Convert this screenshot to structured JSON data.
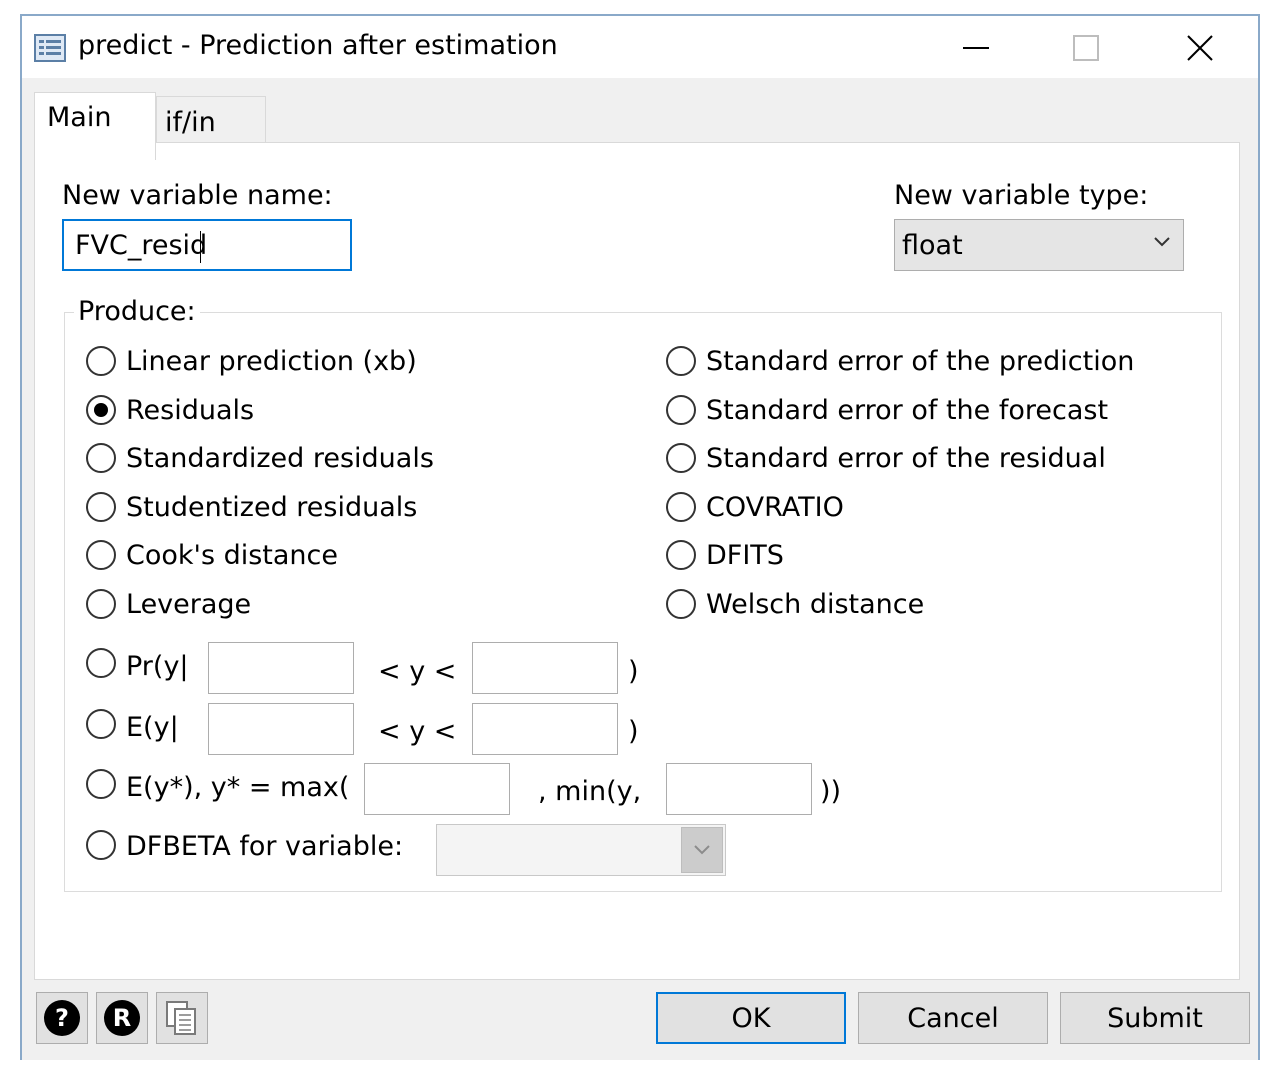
{
  "window": {
    "title": "predict - Prediction after estimation",
    "icon": "dialog-list-icon",
    "controls": [
      "minimize-icon",
      "maximize-icon",
      "close-icon"
    ]
  },
  "tabs": [
    {
      "label": "Main",
      "selected": true
    },
    {
      "label": "if/in",
      "selected": false
    }
  ],
  "new_var": {
    "name_label": "New variable name:",
    "name_value": "FVC_resid",
    "type_label": "New variable type:",
    "type_value": "float"
  },
  "produce": {
    "legend": "Produce:",
    "left": [
      "Linear prediction (xb)",
      "Residuals",
      "Standardized residuals",
      "Studentized residuals",
      "Cook's distance",
      "Leverage"
    ],
    "right": [
      "Standard error of the prediction",
      "Standard error of the forecast",
      "Standard error of the residual",
      "COVRATIO",
      "DFITS",
      "Welsch distance"
    ],
    "selected": "Residuals",
    "pr_label": "Pr(y|",
    "e_label": "E(y|",
    "between_label": "< y <",
    "close_paren": ")",
    "ystar_label": "E(y*), y* = max(",
    "min_label": ", min(y,",
    "close_double": "))",
    "dfbeta_label": "DFBETA for variable:"
  },
  "footer": {
    "help_icon": "help-icon",
    "r_icon": "r-icon",
    "copy_icon": "copy-icon",
    "help_glyph": "?",
    "r_glyph": "R",
    "ok": "OK",
    "cancel": "Cancel",
    "submit": "Submit"
  },
  "colors": {
    "accent": "#0078d7",
    "frame": "#8aa9c9"
  }
}
